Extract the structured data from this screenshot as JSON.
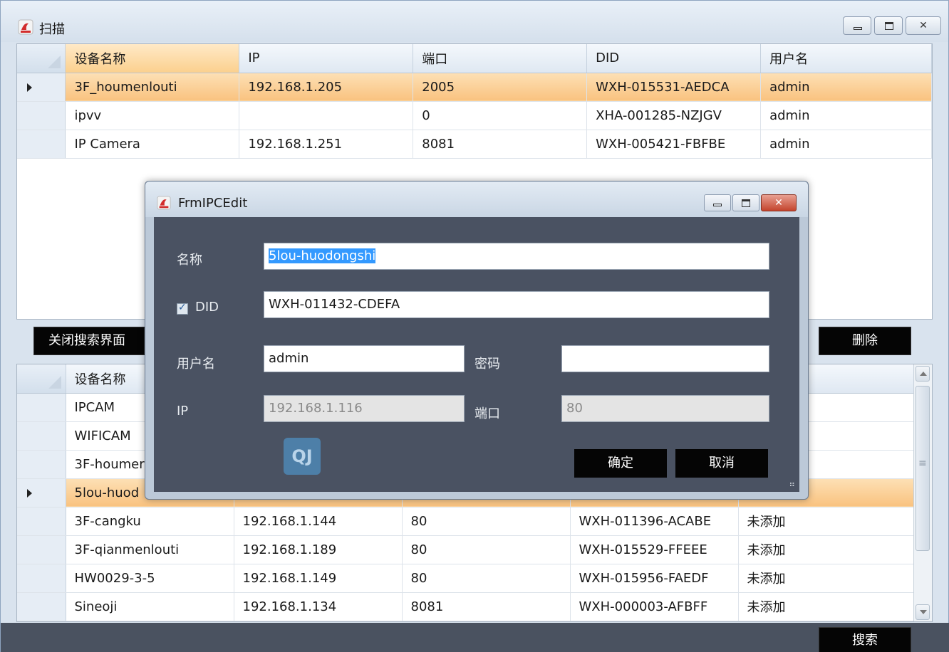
{
  "window": {
    "title": "扫描",
    "controls": {
      "minimize": "",
      "maximize": "",
      "close": "✕"
    }
  },
  "top_grid": {
    "columns": [
      "设备名称",
      "IP",
      "端口",
      "DID",
      "用户名"
    ],
    "rows": [
      {
        "name": "3F_houmenlouti",
        "ip": "192.168.1.205",
        "port": "2005",
        "did": "WXH-015531-AEDCA",
        "user": "admin",
        "selected": true
      },
      {
        "name": "ipvv",
        "ip": "",
        "port": "0",
        "did": "XHA-001285-NZJGV",
        "user": "admin",
        "selected": false
      },
      {
        "name": "IP Camera",
        "ip": "192.168.1.251",
        "port": "8081",
        "did": "WXH-005421-FBFBE",
        "user": "admin",
        "selected": false
      }
    ]
  },
  "toolbar": {
    "close_search_label": "关闭搜索界面",
    "delete_label": "删除",
    "search_label": "搜索"
  },
  "bottom_grid": {
    "columns": [
      "设备名称",
      "",
      "",
      "",
      ""
    ],
    "rows": [
      {
        "name": "IPCAM",
        "ip": "",
        "port": "",
        "did": "",
        "status": "",
        "selected": false
      },
      {
        "name": "WIFICAM",
        "ip": "",
        "port": "",
        "did": "",
        "status": "",
        "selected": false
      },
      {
        "name": "3F-houmer",
        "ip": "",
        "port": "",
        "did": "",
        "status": "",
        "selected": false
      },
      {
        "name": "5lou-huod",
        "ip": "",
        "port": "",
        "did": "",
        "status": "",
        "selected": true
      },
      {
        "name": "3F-cangku",
        "ip": "192.168.1.144",
        "port": "80",
        "did": "WXH-011396-ACABE",
        "status": "未添加",
        "selected": false
      },
      {
        "name": "3F-qianmenlouti",
        "ip": "192.168.1.189",
        "port": "80",
        "did": "WXH-015529-FFEEE",
        "status": "未添加",
        "selected": false
      },
      {
        "name": "HW0029-3-5",
        "ip": "192.168.1.149",
        "port": "80",
        "did": "WXH-015956-FAEDF",
        "status": "未添加",
        "selected": false
      },
      {
        "name": "Sineoji",
        "ip": "192.168.1.134",
        "port": "8081",
        "did": "WXH-000003-AFBFF",
        "status": "未添加",
        "selected": false
      }
    ]
  },
  "dialog": {
    "title": "FrmIPCEdit",
    "close_glyph": "✕",
    "name_label": "名称",
    "name_value": "5lou-huodongshi",
    "did_label": "DID",
    "did_checked": true,
    "did_value": "WXH-011432-CDEFA",
    "user_label": "用户名",
    "user_value": "admin",
    "password_label": "密码",
    "password_value": "",
    "ip_label": "IP",
    "ip_value": "192.168.1.116",
    "port_label": "端口",
    "port_value": "80",
    "ok_label": "确定",
    "cancel_label": "取消",
    "tool_icon_glyph": "QJ"
  },
  "colors": {
    "selection": "#f9c27f",
    "dialog_body": "#4a5262",
    "button_dark": "#050505"
  }
}
